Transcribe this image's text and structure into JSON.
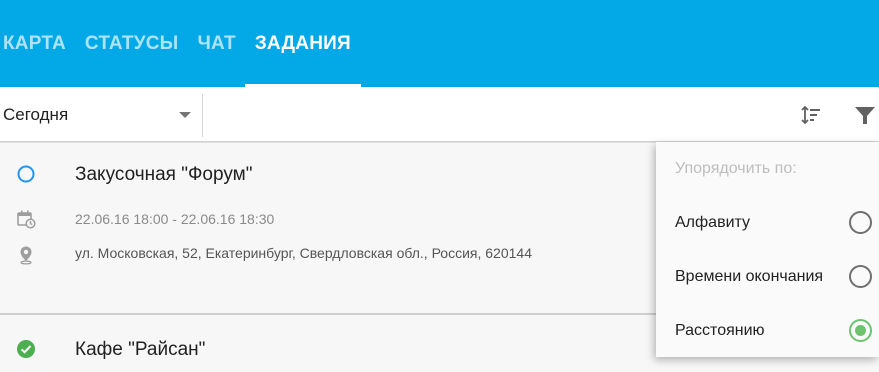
{
  "header": {
    "background": "#03a9e6",
    "tabs": [
      {
        "label": "КАРТА",
        "active": false
      },
      {
        "label": "СТАТУСЫ",
        "active": false
      },
      {
        "label": "ЧАТ",
        "active": false
      },
      {
        "label": "ЗАДАНИЯ",
        "active": true
      }
    ]
  },
  "toolbar": {
    "date_filter": {
      "selected": "Сегодня"
    },
    "icons": [
      "sort-icon",
      "filter-icon"
    ]
  },
  "tasks": [
    {
      "title": "Закусочная \"Форум\"",
      "status": "open",
      "time": "22.06.16 18:00 - 22.06.16 18:30",
      "address": "ул. Московская, 52, Екатеринбург, Свердловская обл., Россия, 620144"
    },
    {
      "title": "Кафе \"Райсан\"",
      "status": "done"
    }
  ],
  "sort_menu": {
    "title": "Упорядочить по:",
    "options": [
      {
        "label": "Алфавиту",
        "checked": false
      },
      {
        "label": "Времени окончания",
        "checked": false
      },
      {
        "label": "Расстоянию",
        "checked": true
      }
    ]
  },
  "colors": {
    "accent": "#03a9e6",
    "open_status": "#2196f3",
    "done_status": "#4caf50",
    "radio_checked": "#6fc36f"
  }
}
